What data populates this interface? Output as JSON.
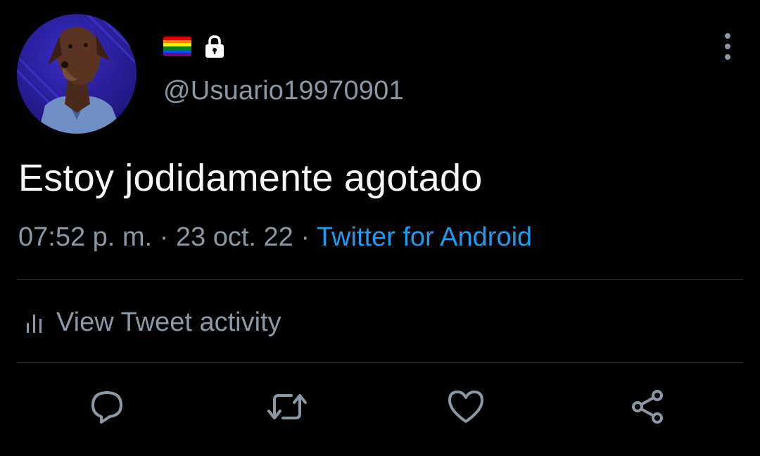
{
  "tweet": {
    "handle": "@Usuario19970901",
    "text": "Estoy jodidamente agotado",
    "time": "07:52 p. m.",
    "separator": "·",
    "date": "23 oct. 22",
    "source": "Twitter for Android",
    "badges": [
      "rainbow-flag-emoji",
      "lock-icon"
    ]
  },
  "activity": {
    "label": "View Tweet activity"
  },
  "actions": [
    "reply-icon",
    "retweet-icon",
    "like-icon",
    "share-icon"
  ],
  "colors": {
    "background": "#000000",
    "text": "#f7f9f9",
    "secondary": "#8b98a5",
    "link": "#1d9bf0",
    "divider": "#2f3336"
  }
}
